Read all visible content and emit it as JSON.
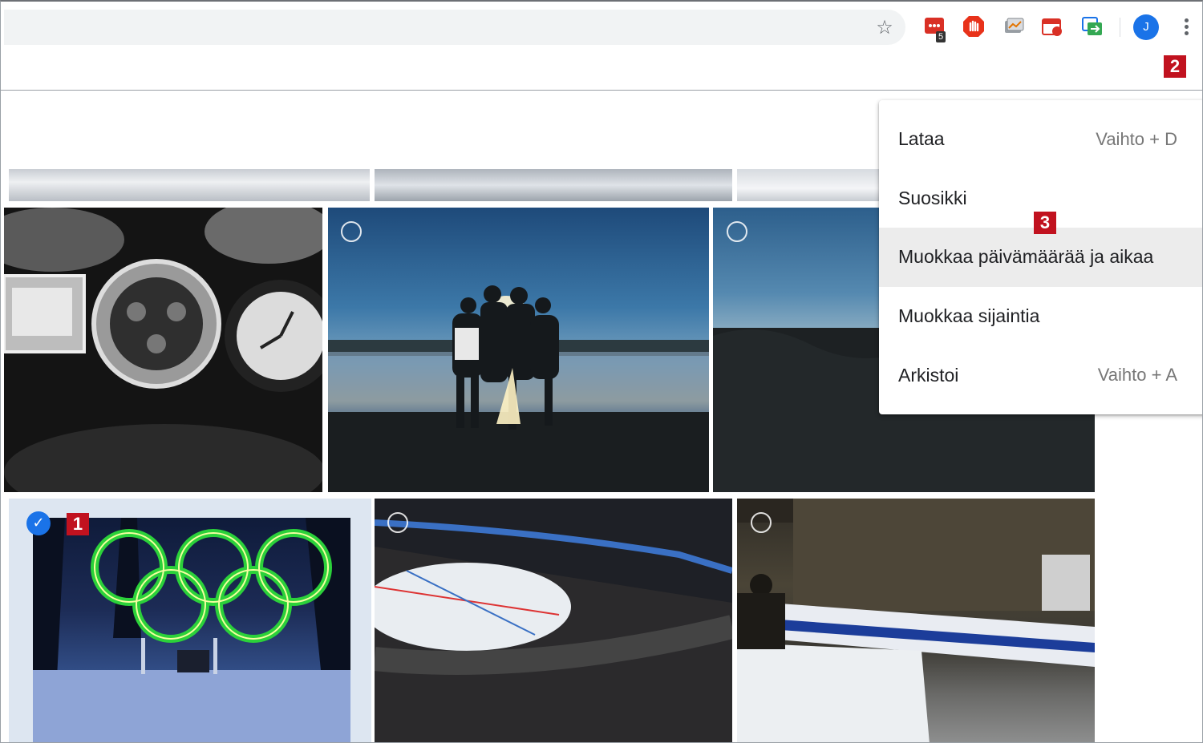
{
  "browser": {
    "extension_badge": "5",
    "profile_initial": "J"
  },
  "menu": {
    "items": [
      {
        "label": "Lataa",
        "shortcut": "Vaihto + D"
      },
      {
        "label": "Suosikki",
        "shortcut": ""
      },
      {
        "label": "Muokkaa päivämäärää ja aikaa",
        "shortcut": ""
      },
      {
        "label": "Muokkaa sijaintia",
        "shortcut": ""
      },
      {
        "label": "Arkistoi",
        "shortcut": "Vaihto + A"
      }
    ]
  },
  "callouts": {
    "step1": "1",
    "step2": "2",
    "step3": "3"
  },
  "colors": {
    "callout": "#c1121f",
    "selected": "#1a73e8"
  }
}
